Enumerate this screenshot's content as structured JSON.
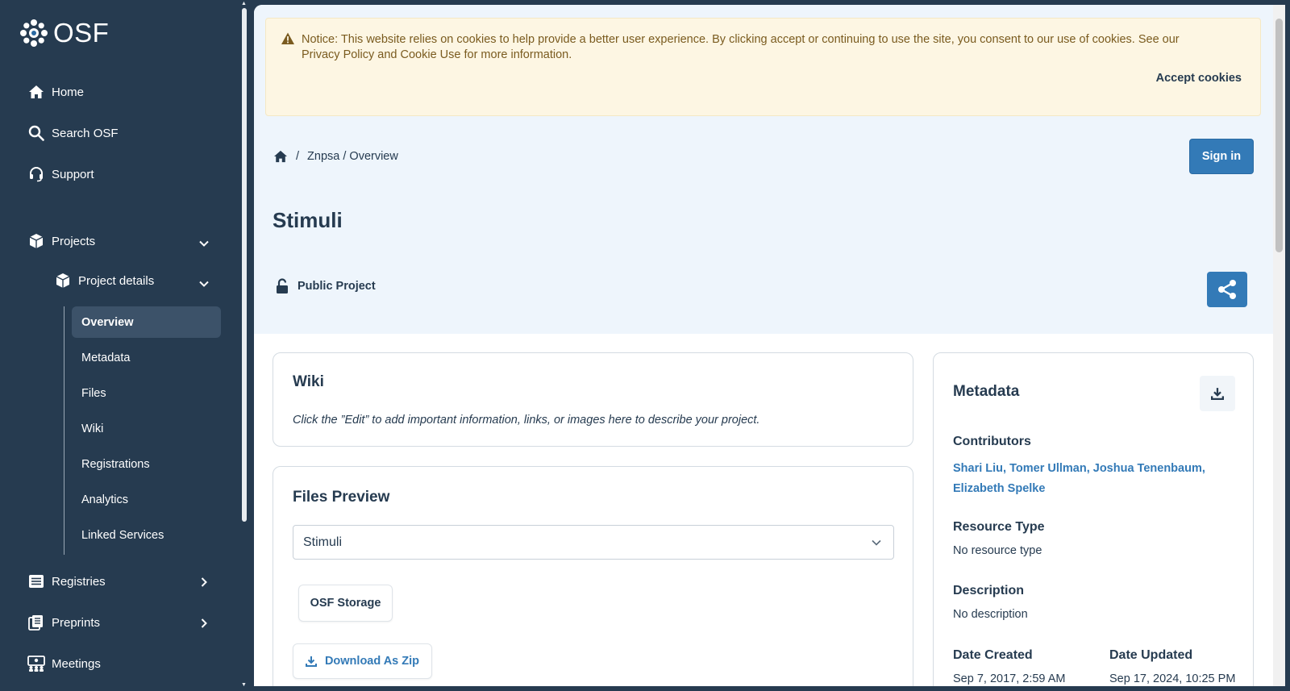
{
  "sidebar": {
    "logo_text": "OSF",
    "nav": [
      {
        "label": "Home",
        "icon": "home-icon"
      },
      {
        "label": "Search OSF",
        "icon": "search-icon"
      },
      {
        "label": "Support",
        "icon": "headset-icon"
      }
    ],
    "projects_label": "Projects",
    "project_details_label": "Project details",
    "subnav": [
      "Overview",
      "Metadata",
      "Files",
      "Wiki",
      "Registrations",
      "Analytics",
      "Linked Services"
    ],
    "registries_label": "Registries",
    "preprints_label": "Preprints",
    "meetings_label": "Meetings"
  },
  "cookie": {
    "notice": "Notice: This website relies on cookies to help provide a better user experience. By clicking accept or continuing to use the site, you consent to our use of cookies. See our Privacy Policy and Cookie Use for more information.",
    "accept_label": "Accept cookies"
  },
  "breadcrumb": {
    "separator": "/",
    "path": "Znpsa / Overview"
  },
  "signin_label": "Sign in",
  "page_title": "Stimuli",
  "visibility_label": "Public Project",
  "wiki": {
    "title": "Wiki",
    "text": "Click the ”Edit” to add important information, links, or images here to describe your project."
  },
  "files_preview": {
    "title": "Files Preview",
    "selected": "Stimuli",
    "storage_label": "OSF Storage",
    "download_zip_label": "Download As Zip"
  },
  "metadata": {
    "title": "Metadata",
    "contributors_label": "Contributors",
    "contributors": "Shari Liu, Tomer Ullman, Joshua Tenenbaum, Elizabeth Spelke",
    "resource_type_label": "Resource Type",
    "resource_type_value": "No resource type",
    "description_label": "Description",
    "description_value": "No description",
    "date_created_label": "Date Created",
    "date_created_value": "Sep 7, 2017, 2:59 AM",
    "date_updated_label": "Date Updated",
    "date_updated_value": "Sep 17, 2024, 10:25 PM"
  },
  "colors": {
    "sidebar_bg": "#263b50",
    "primary": "#337ab7",
    "hero_bg": "#eef5fc",
    "cookie_bg": "#fdf6e3"
  }
}
